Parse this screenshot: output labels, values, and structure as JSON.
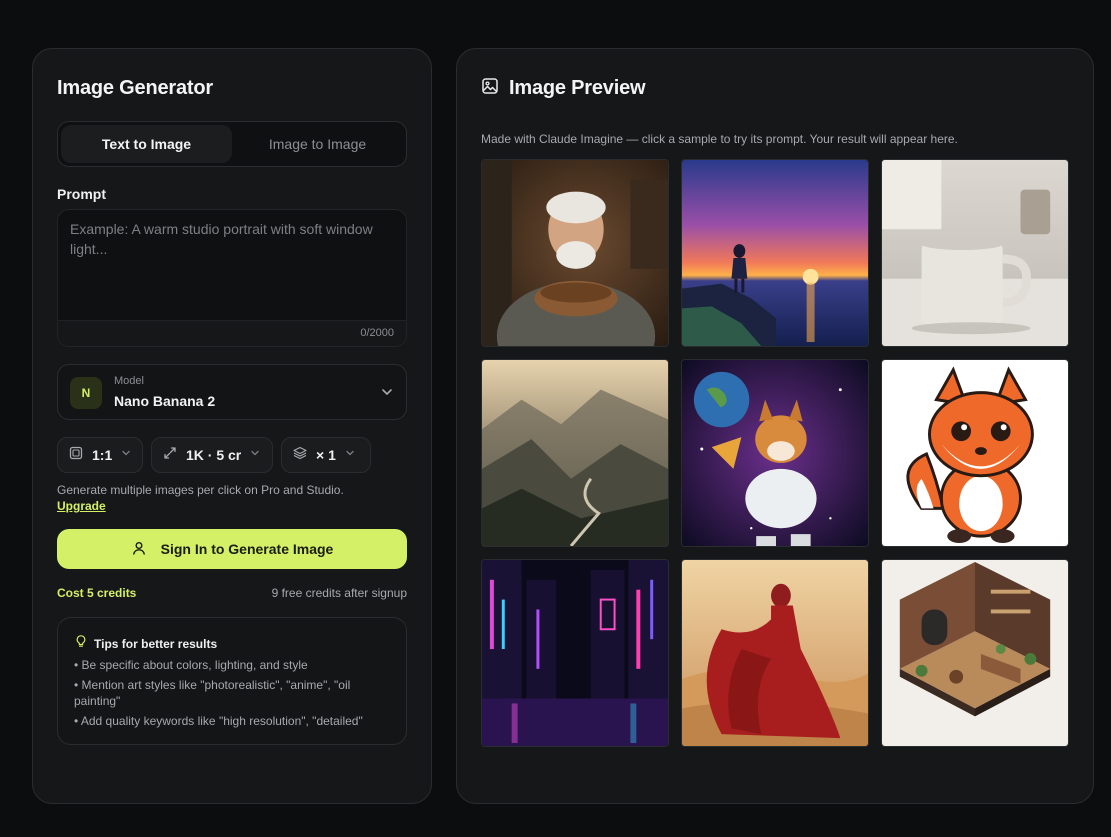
{
  "generator": {
    "title": "Image Generator",
    "tabs": [
      {
        "label": "Text to Image",
        "active": true
      },
      {
        "label": "Image to Image",
        "active": false
      }
    ],
    "prompt": {
      "label": "Prompt",
      "value": "",
      "placeholder": "Example: A warm studio portrait with soft window light...",
      "char_count": "0/2000"
    },
    "model": {
      "caption": "Model",
      "badge": "N",
      "name": "Nano Banana 2"
    },
    "options": {
      "ratio": "1:1",
      "resolution": "1K · 5 cr",
      "count": "× 1"
    },
    "multi_note": "Generate multiple images per click on Pro and Studio.",
    "upgrade_label": "Upgrade",
    "signin_label": "Sign In to Generate Image",
    "cost": "Cost 5 credits",
    "free_credits": "9 free credits after signup",
    "tips": {
      "title": "Tips for better results",
      "items": [
        "• Be specific about colors, lighting, and style",
        "• Mention art styles like \"photorealistic\", \"anime\", \"oil painting\"",
        "• Add quality keywords like \"high resolution\", \"detailed\""
      ]
    }
  },
  "preview": {
    "title": "Image Preview",
    "description": "Made with Claude Imagine — click a sample to try its prompt. Your result will appear here."
  },
  "colors": {
    "accent": "#d3f067",
    "panel": "#151718",
    "background": "#0c0d0e"
  }
}
